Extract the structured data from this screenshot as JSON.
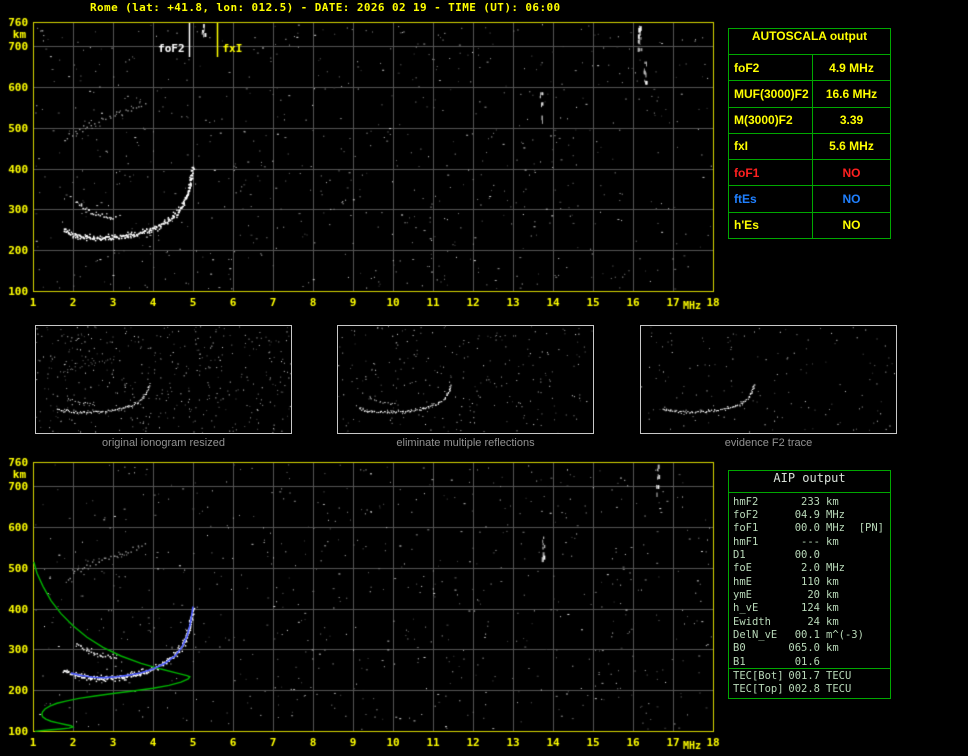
{
  "title": "Rome (lat: +41.8, lon: 012.5) - DATE: 2026 02 19 - TIME (UT): 06:00",
  "colors": {
    "title": "#ffff00",
    "axis_labels": "#ffff00",
    "plot_frame": "#d6d600",
    "grid": "#555555",
    "table_border": "#00a800",
    "aip_text": "#b8d8b8",
    "fof1_no": "#ff2020",
    "ftes_no": "#2080ff",
    "profile": "#00b400",
    "restored_trace": "#4858ff"
  },
  "autoscala_table": {
    "header": "AUTOSCALA output",
    "rows": [
      {
        "label": "foF2",
        "value": "4.9 MHz",
        "color": "#ffff00"
      },
      {
        "label": "MUF(3000)F2",
        "value": "16.6 MHz",
        "color": "#ffff00"
      },
      {
        "label": "M(3000)F2",
        "value": "3.39",
        "color": "#ffff00"
      },
      {
        "label": "fxI",
        "value": "5.6 MHz",
        "color": "#ffff00"
      },
      {
        "label": "foF1",
        "value": "NO",
        "color": "#ff2020"
      },
      {
        "label": "ftEs",
        "value": "NO",
        "color": "#2080ff"
      },
      {
        "label": "h'Es",
        "value": "NO",
        "color": "#ffff00"
      }
    ]
  },
  "thumbnails": [
    {
      "caption": "original ionogram resized",
      "xlim": [
        1,
        10
      ],
      "ylim": [
        100,
        760
      ],
      "seed": 11,
      "noise": 430,
      "show_second_hop": true,
      "show_upper": true
    },
    {
      "caption": "eliminate multiple reflections",
      "xlim": [
        1,
        10
      ],
      "ylim": [
        100,
        760
      ],
      "seed": 12,
      "noise": 260,
      "show_second_hop": false,
      "show_upper": true
    },
    {
      "caption": "evidence F2 trace",
      "xlim": [
        1,
        10
      ],
      "ylim": [
        100,
        760
      ],
      "seed": 13,
      "noise": 150,
      "show_second_hop": false,
      "show_upper": false
    }
  ],
  "aip_table": {
    "header": "AIP output",
    "rows": [
      {
        "label": "hmF2",
        "value": "233",
        "unit": "km",
        "extra": ""
      },
      {
        "label": "foF2",
        "value": "04.9",
        "unit": "MHz",
        "extra": ""
      },
      {
        "label": "foF1",
        "value": "00.0",
        "unit": "MHz",
        "extra": "[PN]"
      },
      {
        "label": "hmF1",
        "value": "---",
        "unit": "km",
        "extra": ""
      },
      {
        "label": "D1",
        "value": "00.0",
        "unit": "",
        "extra": ""
      },
      {
        "label": "foE",
        "value": "2.0",
        "unit": "MHz",
        "extra": ""
      },
      {
        "label": "hmE",
        "value": "110",
        "unit": "km",
        "extra": ""
      },
      {
        "label": "ymE",
        "value": "20",
        "unit": "km",
        "extra": ""
      },
      {
        "label": "h_vE",
        "value": "124",
        "unit": "km",
        "extra": ""
      },
      {
        "label": "Ewidth",
        "value": "24",
        "unit": "km",
        "extra": ""
      },
      {
        "label": "DelN_vE",
        "value": "00.1",
        "unit": "m^(-3)",
        "extra": ""
      },
      {
        "label": "B0",
        "value": "065.0",
        "unit": "km",
        "extra": ""
      },
      {
        "label": "B1",
        "value": "01.6",
        "unit": "",
        "extra": ""
      },
      {
        "label": "TEC[Bot]",
        "value": "001.7",
        "unit": "TECU",
        "extra": "",
        "sep": true
      },
      {
        "label": "TEC[Top]",
        "value": "002.8",
        "unit": "TECU",
        "extra": ""
      }
    ]
  },
  "chart_data": [
    {
      "id": "main_ionogram",
      "type": "scatter",
      "xlabel": "MHz",
      "ylabel": "km",
      "xlim": [
        1,
        18
      ],
      "ylim": [
        100,
        760
      ],
      "x_ticks": [
        1,
        2,
        3,
        4,
        5,
        6,
        7,
        8,
        9,
        10,
        11,
        12,
        13,
        14,
        15,
        16,
        17,
        18
      ],
      "y_ticks": [
        100,
        200,
        300,
        400,
        500,
        600,
        700,
        760
      ],
      "grid": true,
      "noise_seed": 7,
      "noise_count": 750,
      "streaks": [
        [
          16.15,
          695,
          757
        ],
        [
          16.3,
          610,
          668
        ],
        [
          13.7,
          505,
          590
        ],
        [
          5.25,
          730,
          757
        ]
      ],
      "second_hop": [
        [
          1.85,
          478
        ],
        [
          2.1,
          492
        ],
        [
          2.4,
          508
        ],
        [
          2.75,
          522
        ],
        [
          3.1,
          535
        ],
        [
          3.5,
          548
        ],
        [
          3.85,
          558
        ]
      ],
      "f2_upper_trace": [
        [
          2.1,
          318
        ],
        [
          2.25,
          305
        ],
        [
          2.45,
          295
        ],
        [
          2.65,
          288
        ],
        [
          2.9,
          283
        ],
        [
          3.1,
          281
        ]
      ],
      "f2_trace": [
        [
          1.75,
          252
        ],
        [
          1.9,
          243
        ],
        [
          2.1,
          237
        ],
        [
          2.4,
          233
        ],
        [
          2.7,
          231
        ],
        [
          3.0,
          232
        ],
        [
          3.3,
          236
        ],
        [
          3.6,
          241
        ],
        [
          3.9,
          250
        ],
        [
          4.15,
          261
        ],
        [
          4.4,
          276
        ],
        [
          4.6,
          294
        ],
        [
          4.75,
          316
        ],
        [
          4.87,
          347
        ],
        [
          4.95,
          380
        ],
        [
          5.0,
          405
        ]
      ],
      "markers": [
        {
          "label": "foF2",
          "freq": 4.9,
          "color": "#ffffff",
          "side": "left"
        },
        {
          "label": "fxI",
          "freq": 5.6,
          "color": "#ffff00",
          "side": "right"
        }
      ]
    },
    {
      "id": "restored_ionogram_with_profile",
      "type": "scatter",
      "xlabel": "MHz",
      "ylabel": "km",
      "xlim": [
        1,
        18
      ],
      "ylim": [
        100,
        760
      ],
      "x_ticks": [
        1,
        2,
        3,
        4,
        5,
        6,
        7,
        8,
        9,
        10,
        11,
        12,
        13,
        14,
        15,
        16,
        17,
        18
      ],
      "y_ticks": [
        100,
        200,
        300,
        400,
        500,
        600,
        700,
        760
      ],
      "grid": true,
      "noise_seed": 9,
      "noise_count": 700,
      "streaks": [
        [
          16.6,
          680,
          755
        ],
        [
          13.75,
          505,
          585
        ]
      ],
      "second_hop": [
        [
          1.85,
          478
        ],
        [
          2.1,
          492
        ],
        [
          2.4,
          508
        ],
        [
          2.75,
          522
        ],
        [
          3.1,
          535
        ],
        [
          3.5,
          548
        ],
        [
          3.85,
          558
        ]
      ],
      "f2_upper_trace": [
        [
          2.1,
          318
        ],
        [
          2.25,
          305
        ],
        [
          2.45,
          295
        ],
        [
          2.65,
          288
        ],
        [
          2.9,
          283
        ],
        [
          3.1,
          281
        ]
      ],
      "f2_trace": [
        [
          1.75,
          252
        ],
        [
          1.9,
          243
        ],
        [
          2.1,
          237
        ],
        [
          2.4,
          233
        ],
        [
          2.7,
          231
        ],
        [
          3.0,
          232
        ],
        [
          3.3,
          236
        ],
        [
          3.6,
          241
        ],
        [
          3.9,
          250
        ],
        [
          4.15,
          261
        ],
        [
          4.4,
          276
        ],
        [
          4.6,
          294
        ],
        [
          4.75,
          316
        ],
        [
          4.87,
          347
        ],
        [
          4.95,
          380
        ],
        [
          5.0,
          405
        ]
      ],
      "profile_green": [
        [
          1.02,
          515
        ],
        [
          1.1,
          487
        ],
        [
          1.25,
          455
        ],
        [
          1.45,
          420
        ],
        [
          1.7,
          388
        ],
        [
          2.0,
          358
        ],
        [
          2.35,
          330
        ],
        [
          2.75,
          305
        ],
        [
          3.2,
          284
        ],
        [
          3.7,
          266
        ],
        [
          4.2,
          252
        ],
        [
          4.6,
          242
        ],
        [
          4.85,
          236
        ],
        [
          4.92,
          233
        ],
        [
          4.88,
          228
        ],
        [
          4.7,
          220
        ],
        [
          4.4,
          212
        ],
        [
          4.0,
          205
        ],
        [
          3.5,
          198
        ],
        [
          3.0,
          192
        ],
        [
          2.55,
          186
        ],
        [
          2.15,
          180
        ],
        [
          1.85,
          174
        ],
        [
          1.6,
          168
        ],
        [
          1.42,
          161
        ],
        [
          1.3,
          154
        ],
        [
          1.24,
          147
        ],
        [
          1.22,
          141
        ],
        [
          1.24,
          135
        ],
        [
          1.32,
          129
        ],
        [
          1.45,
          124
        ],
        [
          1.62,
          120
        ],
        [
          1.8,
          116
        ],
        [
          1.95,
          113
        ],
        [
          2.0,
          110
        ],
        [
          1.9,
          107
        ],
        [
          1.7,
          105
        ],
        [
          1.45,
          103
        ],
        [
          1.2,
          101
        ],
        [
          1.05,
          99
        ]
      ],
      "trace_blue": [
        [
          1.95,
          242
        ],
        [
          2.2,
          236
        ],
        [
          2.5,
          232
        ],
        [
          2.8,
          231
        ],
        [
          3.1,
          233
        ],
        [
          3.4,
          237
        ],
        [
          3.7,
          243
        ],
        [
          4.0,
          252
        ],
        [
          4.3,
          266
        ],
        [
          4.55,
          284
        ],
        [
          4.72,
          305
        ],
        [
          4.85,
          332
        ],
        [
          4.93,
          362
        ],
        [
          4.98,
          392
        ],
        [
          5.0,
          405
        ]
      ],
      "markers": []
    }
  ]
}
